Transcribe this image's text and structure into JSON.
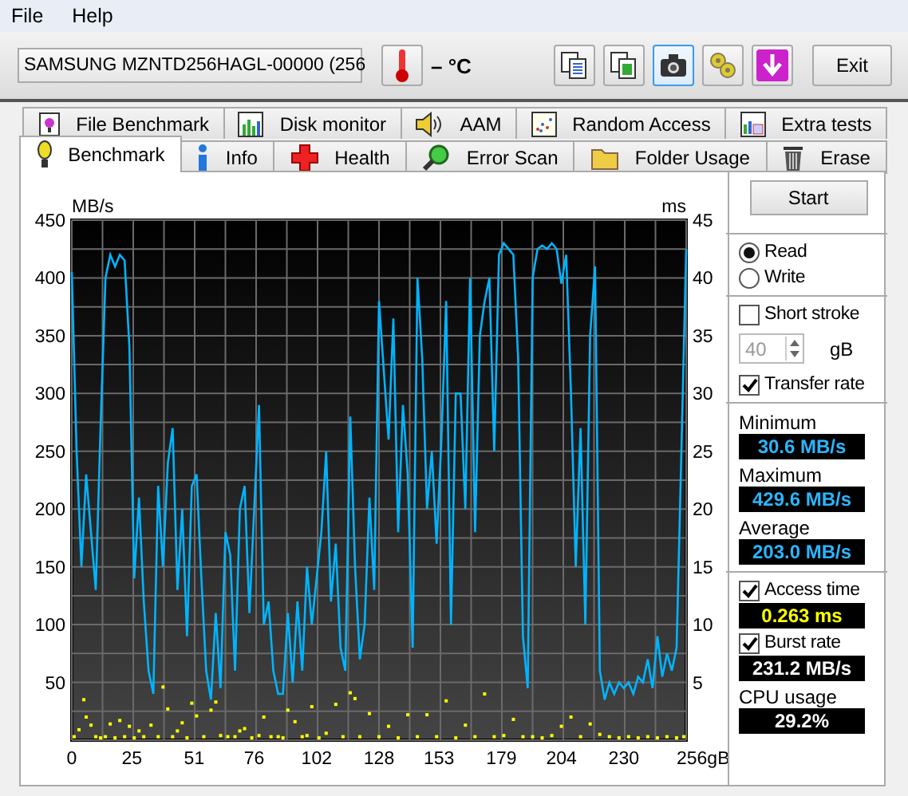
{
  "menu": [
    {
      "label": "File"
    },
    {
      "label": "Help"
    }
  ],
  "toolbar": {
    "drive": "SAMSUNG MZNTD256HAGL-00000 (256",
    "temperature": "– °C",
    "tools": [
      {
        "kind": "copy",
        "highlighted": false
      },
      {
        "kind": "copy-info",
        "highlighted": false
      },
      {
        "kind": "camera",
        "highlighted": true
      },
      {
        "kind": "options",
        "highlighted": false
      },
      {
        "kind": "save",
        "highlighted": false
      }
    ],
    "exit": "Exit"
  },
  "tabs_back": [
    {
      "label": "File Benchmark",
      "kind": "file"
    },
    {
      "label": "Disk monitor",
      "kind": "monitor"
    },
    {
      "label": "AAM",
      "kind": "speaker"
    },
    {
      "label": "Random Access",
      "kind": "random"
    },
    {
      "label": "Extra tests",
      "kind": "extra"
    }
  ],
  "tabs_front": [
    {
      "label": "Benchmark",
      "kind": "bulb",
      "selected": true
    },
    {
      "label": "Info",
      "kind": "info",
      "selected": false
    },
    {
      "label": "Health",
      "kind": "health",
      "selected": false
    },
    {
      "label": "Error Scan",
      "kind": "scan",
      "selected": false
    },
    {
      "label": "Folder Usage",
      "kind": "folder",
      "selected": false
    },
    {
      "label": "Erase",
      "kind": "erase",
      "selected": false
    }
  ],
  "chart": {
    "chart_data": {
      "type": "line",
      "ylabel": "MB/s",
      "y2label": "ms",
      "xlim": [
        0,
        256
      ],
      "ylim": [
        0,
        450
      ],
      "xticks": [
        0,
        25,
        51,
        76,
        102,
        128,
        153,
        179,
        204,
        230,
        {
          "value": 256,
          "label": "256gB"
        }
      ],
      "yticks": [
        50,
        100,
        150,
        200,
        250,
        300,
        350,
        400,
        450
      ],
      "y2ticks": [
        5,
        10,
        15,
        20,
        25,
        30,
        35,
        40,
        45
      ],
      "y2lim": [
        0,
        45
      ],
      "grid": true,
      "series": [
        {
          "axis": "y",
          "color": "#00b4ff",
          "x": [
            0,
            2,
            4,
            6,
            8,
            10,
            12,
            14,
            16,
            18,
            20,
            22,
            24,
            26,
            28,
            30,
            32,
            34,
            36,
            38,
            40,
            42,
            44,
            46,
            48,
            50,
            52,
            54,
            56,
            58,
            60,
            62,
            64,
            66,
            68,
            70,
            72,
            74,
            76,
            78,
            80,
            82,
            84,
            86,
            88,
            90,
            92,
            94,
            96,
            98,
            100,
            102,
            104,
            106,
            108,
            110,
            112,
            114,
            116,
            118,
            120,
            122,
            124,
            126,
            128,
            130,
            132,
            134,
            136,
            138,
            140,
            142,
            144,
            146,
            148,
            150,
            152,
            154,
            156,
            158,
            160,
            162,
            164,
            166,
            168,
            170,
            172,
            174,
            176,
            178,
            180,
            182,
            184,
            186,
            188,
            190,
            192,
            194,
            196,
            198,
            200,
            202,
            204,
            206,
            208,
            210,
            212,
            214,
            216,
            218,
            220,
            222,
            224,
            226,
            228,
            230,
            232,
            234,
            236,
            238,
            240,
            242,
            244,
            246,
            248,
            250,
            252,
            254,
            256
          ],
          "values": [
            405,
            250,
            150,
            230,
            180,
            130,
            270,
            400,
            420,
            410,
            420,
            415,
            340,
            140,
            210,
            120,
            60,
            40,
            220,
            150,
            240,
            270,
            130,
            200,
            90,
            220,
            230,
            140,
            60,
            35,
            110,
            45,
            180,
            160,
            60,
            200,
            220,
            110,
            200,
            290,
            100,
            120,
            60,
            40,
            40,
            110,
            50,
            120,
            60,
            150,
            100,
            140,
            180,
            250,
            120,
            170,
            80,
            60,
            280,
            150,
            70,
            100,
            210,
            130,
            380,
            320,
            260,
            365,
            180,
            290,
            230,
            80,
            400,
            330,
            200,
            250,
            170,
            260,
            380,
            100,
            300,
            300,
            200,
            400,
            180,
            350,
            380,
            400,
            250,
            420,
            430,
            425,
            420,
            330,
            90,
            45,
            400,
            425,
            428,
            425,
            430,
            425,
            395,
            420,
            300,
            150,
            270,
            100,
            350,
            410,
            60,
            35,
            50,
            40,
            50,
            45,
            50,
            40,
            55,
            50,
            70,
            45,
            90,
            55,
            75,
            60,
            80,
            250,
            425
          ]
        },
        {
          "type": "scatter",
          "axis": "y2",
          "color": "#ffff00",
          "x": [
            1,
            3,
            5,
            6,
            8,
            10,
            12,
            14,
            16,
            18,
            20,
            22,
            24,
            26,
            28,
            30,
            33,
            36,
            38,
            40,
            42,
            44,
            46,
            48,
            50,
            52,
            55,
            58,
            60,
            62,
            65,
            68,
            70,
            72,
            75,
            78,
            80,
            83,
            86,
            88,
            90,
            93,
            96,
            98,
            100,
            103,
            106,
            110,
            113,
            116,
            118,
            120,
            124,
            128,
            132,
            136,
            140,
            144,
            148,
            152,
            156,
            160,
            164,
            168,
            172,
            176,
            180,
            184,
            188,
            192,
            196,
            200,
            204,
            208,
            212,
            216,
            220,
            224,
            228,
            232,
            236,
            240,
            244,
            248,
            252,
            255
          ],
          "values": [
            0.3,
            0.9,
            3.5,
            2,
            1.3,
            0.3,
            0.2,
            0.3,
            1.4,
            0.2,
            1.7,
            0.3,
            1.2,
            0.2,
            0.8,
            0.3,
            1.3,
            0.3,
            4.6,
            2.7,
            0.3,
            0.8,
            1.5,
            0.2,
            3.2,
            2.1,
            0.3,
            2.6,
            3.3,
            0.4,
            0.3,
            0.3,
            0.8,
            1.0,
            0.2,
            0.4,
            2.0,
            0.3,
            0.3,
            0.2,
            2.6,
            1.6,
            0.3,
            0.4,
            2.9,
            0.2,
            0.6,
            3.1,
            0.3,
            4.1,
            3.6,
            0.3,
            2.3,
            0.3,
            1.2,
            0.2,
            2.2,
            0.3,
            2.2,
            0.3,
            3.4,
            0.2,
            1.3,
            0.3,
            4.0,
            0.3,
            0.4,
            1.8,
            0.3,
            0.3,
            0.2,
            0.4,
            1.2,
            2.0,
            0.3,
            1.4,
            0.5,
            0.3,
            0.2,
            0.3,
            0.2,
            0.3,
            0.2,
            0.3,
            0.2,
            0.3
          ]
        }
      ]
    }
  },
  "side": {
    "start": "Start",
    "modes": [
      {
        "label": "Read",
        "selected": true
      },
      {
        "label": "Write",
        "selected": false
      }
    ],
    "short_stroke": {
      "label": "Short stroke",
      "checked": false,
      "value": "40",
      "unit": "gB"
    },
    "transfer_rate": {
      "label": "Transfer rate",
      "checked": true
    },
    "stats": [
      {
        "label": "Minimum",
        "value": "30.6 MB/s"
      },
      {
        "label": "Maximum",
        "value": "429.6 MB/s"
      },
      {
        "label": "Average",
        "value": "203.0 MB/s"
      }
    ],
    "access_time": {
      "label": "Access time",
      "checked": true,
      "value": "0.263 ms"
    },
    "burst_rate": {
      "label": "Burst rate",
      "checked": true,
      "value": "231.2 MB/s"
    },
    "cpu": {
      "label": "CPU usage",
      "value": "29.2%"
    }
  }
}
